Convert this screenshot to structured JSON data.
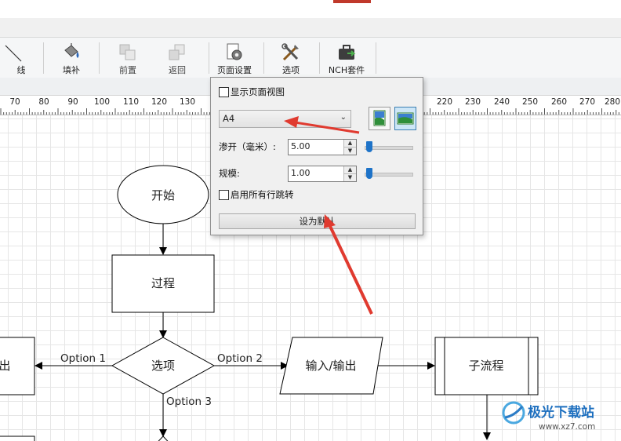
{
  "toolbar": {
    "line_label": "线",
    "fill_label": "填补",
    "front_label": "前置",
    "back_label": "返回",
    "page_setup_label": "页面设置",
    "options_label": "选项",
    "nch_label": "NCH套件"
  },
  "ruler": {
    "ticks": [
      "70",
      "80",
      "90",
      "100",
      "110",
      "120",
      "130",
      "220",
      "230",
      "240",
      "250",
      "260",
      "270",
      "280"
    ]
  },
  "diagram": {
    "start": "开始",
    "process": "过程",
    "decision": "选项",
    "io": "输入/输出",
    "subprocess": "子流程",
    "left_fragment": "出",
    "option1": "Option 1",
    "option2": "Option 2",
    "option3": "Option 3"
  },
  "page_setup_panel": {
    "show_page_view_label": "显示页面视图",
    "show_page_view_checked": false,
    "paper_size": "A4",
    "bleed_label": "渗开（毫米）:",
    "bleed_value": "5.00",
    "scale_label": "规模:",
    "scale_value": "1.00",
    "enable_line_jump_label": "启用所有行跳转",
    "enable_line_jump_checked": false,
    "set_default_label": "设为默认",
    "orientation_selected": "landscape"
  },
  "watermark": {
    "text": "极光下载站",
    "url": "www.xz7.com"
  },
  "colors": {
    "annotation_arrow": "#e03a2f",
    "slider_thumb": "#1e73c8",
    "selected_orientation": "#cde6f7"
  }
}
